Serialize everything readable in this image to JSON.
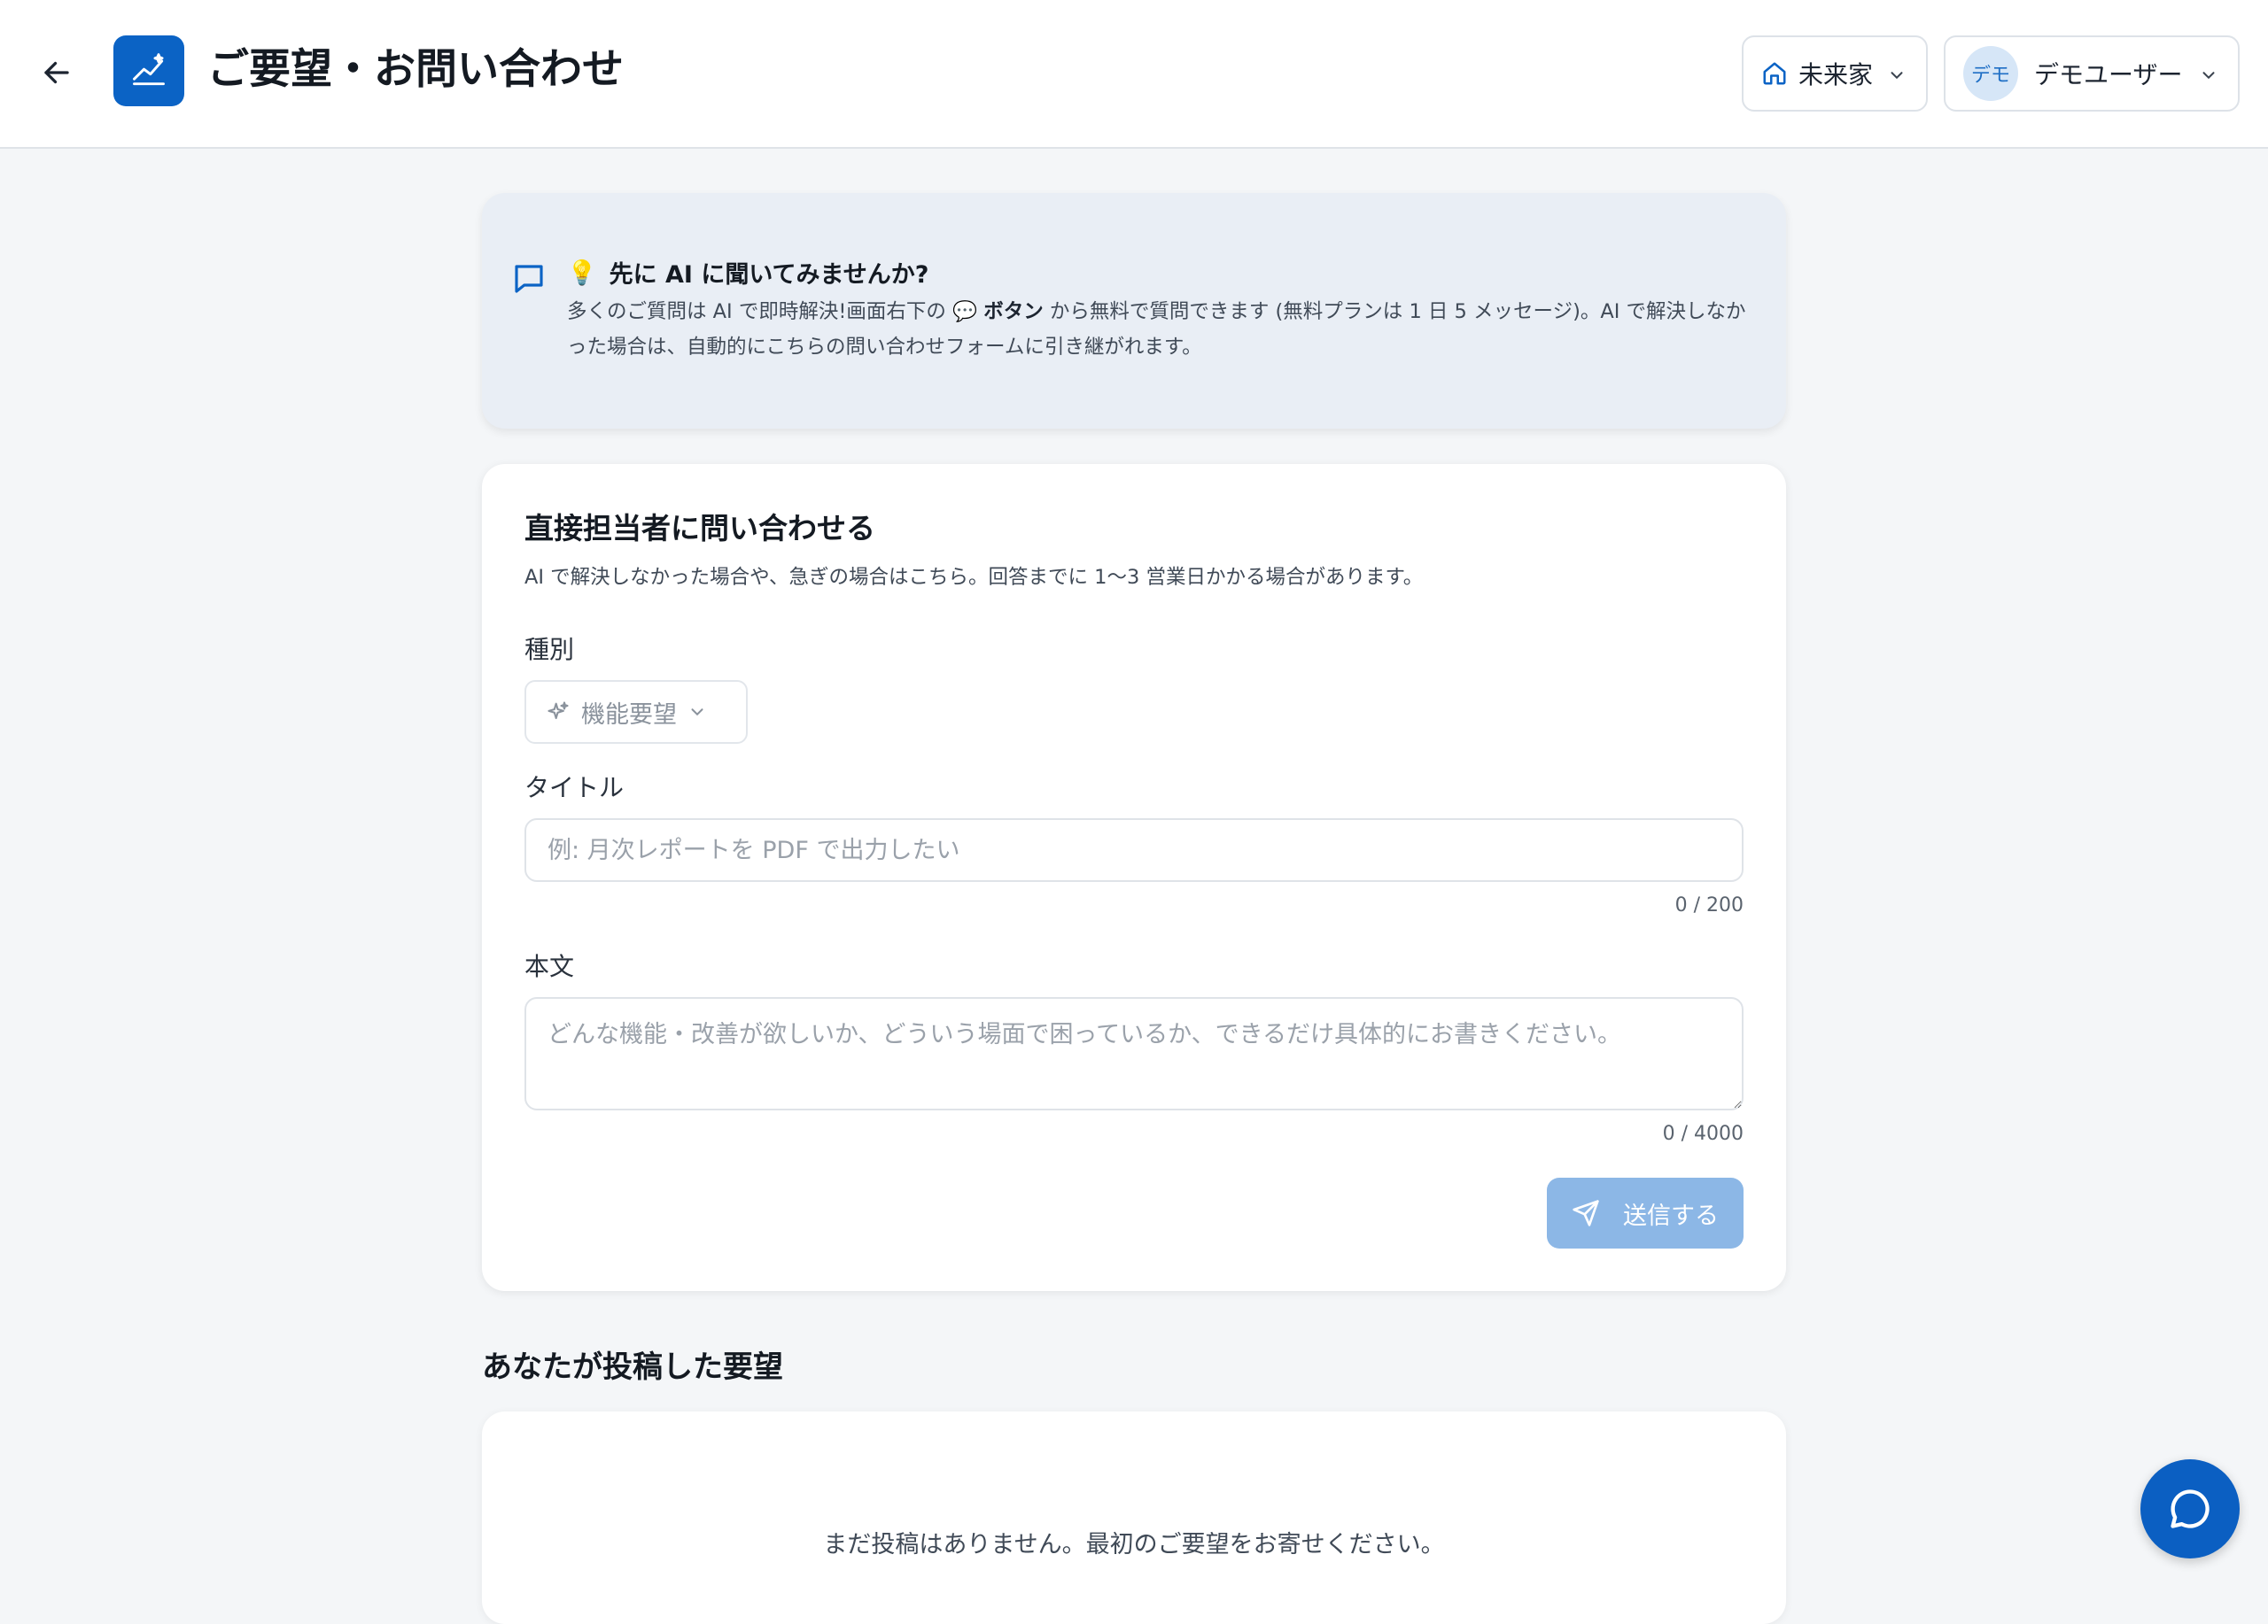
{
  "header": {
    "title": "ご要望・お問い合わせ",
    "home_label": "未来家",
    "user_avatar": "デモ",
    "user_name": "デモユーザー",
    "icons": {
      "back": "arrow-left-icon",
      "logo": "trending-up-icon",
      "home": "home-icon",
      "chevron": "chevron-down-icon"
    }
  },
  "ai_banner": {
    "bulb": "💡",
    "title": "先に AI に聞いてみませんか?",
    "text_part1": "多くのご質問は AI で即時解決!画面右下の",
    "chat_glyph": "💬",
    "button_word": "ボタン",
    "text_part2": "から無料で質問できます (無料プランは 1 日 5 メッセージ)。AI で解決しなかった場合は、自動的にこちらの問い合わせフォームに引き継がれます。",
    "icon": "message-square-icon"
  },
  "form": {
    "title": "直接担当者に問い合わせる",
    "description": "AI で解決しなかった場合や、急ぎの場合はこちら。回答までに 1〜3 営業日かかる場合があります。",
    "type_label": "種別",
    "type_value": "機能要望",
    "title_label": "タイトル",
    "title_placeholder": "例: 月次レポートを PDF で出力したい",
    "title_counter": "0 / 200",
    "body_label": "本文",
    "body_placeholder": "どんな機能・改善が欲しいか、どういう場面で困っているか、できるだけ具体的にお書きください。",
    "body_counter": "0 / 4000",
    "send_label": "送信する",
    "accent_color": "#0b63c5",
    "disabled_button_color": "#8cb7e6"
  },
  "history": {
    "title": "あなたが投稿した要望",
    "empty_text": "まだ投稿はありません。最初のご要望をお寄せください。"
  }
}
